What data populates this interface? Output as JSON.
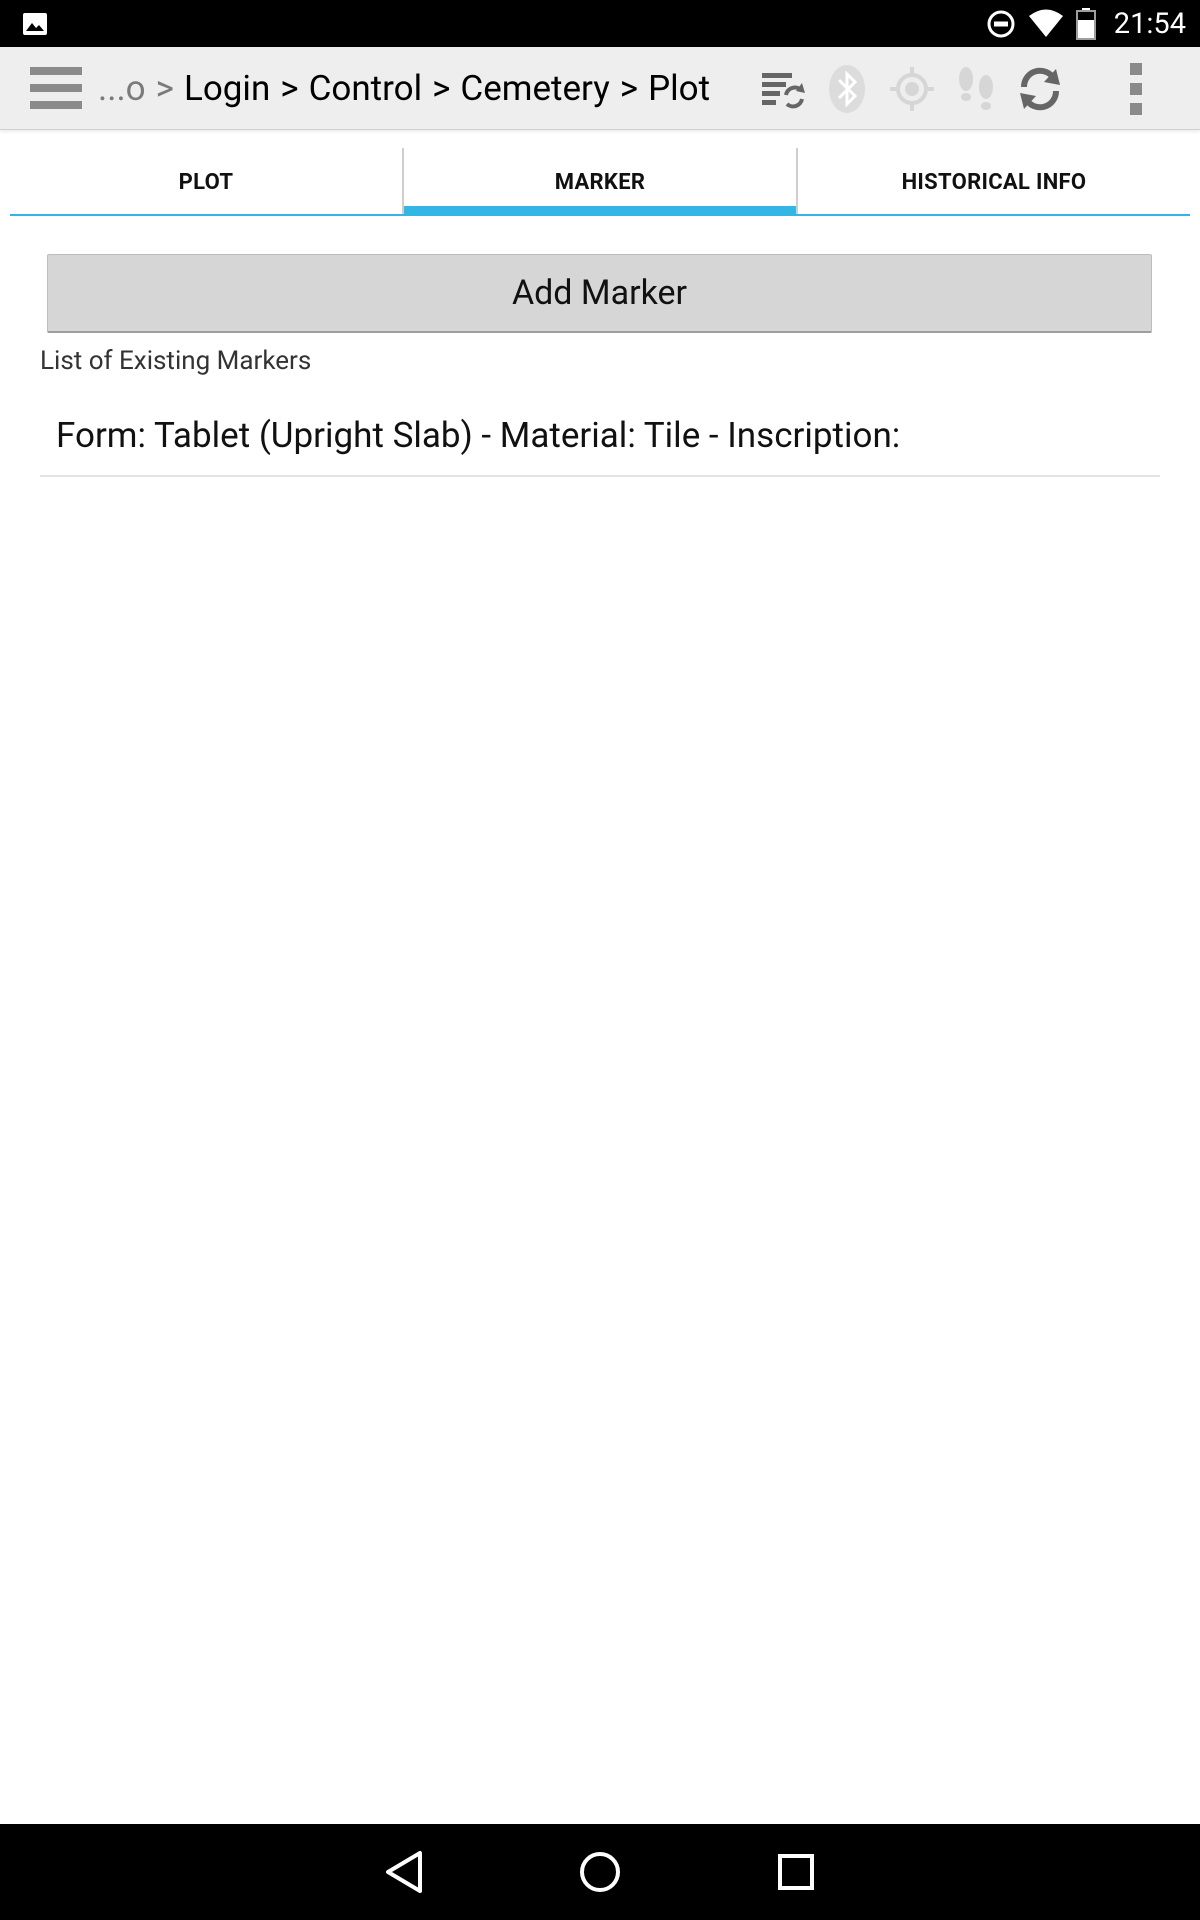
{
  "status_bar": {
    "time": "21:54",
    "icons": [
      "image-icon",
      "do-not-disturb-icon",
      "wifi-icon",
      "battery-icon"
    ]
  },
  "action_bar": {
    "breadcrumb": {
      "ellipsis": "...o",
      "items": [
        "Login",
        "Control",
        "Cemetery",
        "Plot"
      ],
      "separator": ">"
    },
    "icons": [
      "sync-records-icon",
      "bluetooth-icon",
      "gps-icon",
      "footprints-icon",
      "refresh-icon",
      "overflow-menu-icon"
    ]
  },
  "tabs": [
    {
      "label": "PLOT",
      "active": false
    },
    {
      "label": "MARKER",
      "active": true
    },
    {
      "label": "HISTORICAL INFO",
      "active": false
    }
  ],
  "content": {
    "add_button_label": "Add Marker",
    "list_caption": "List of Existing Markers",
    "markers": [
      {
        "text": "Form: Tablet (Upright Slab) - Material: Tile - Inscription:"
      }
    ]
  },
  "colors": {
    "accent": "#33b5e5",
    "action_bar_bg": "#eeeeee",
    "button_bg": "#d6d6d6",
    "system_bar_bg": "#000000"
  },
  "nav_bar": {
    "icons": [
      "back-icon",
      "home-icon",
      "recents-icon"
    ]
  }
}
